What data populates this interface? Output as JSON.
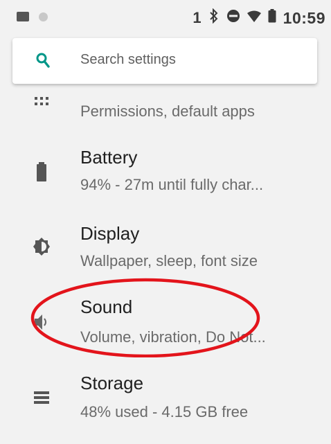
{
  "status_bar": {
    "left_icons": [
      "image-icon",
      "circle-icon"
    ],
    "notification_count": "1",
    "time": "10:59",
    "right_icons": [
      "bluetooth-icon",
      "do-not-disturb-icon",
      "wifi-icon",
      "battery-icon"
    ]
  },
  "search": {
    "placeholder": "Search settings",
    "icon": "search-icon",
    "accent_color": "#009688"
  },
  "settings_items": [
    {
      "title": "",
      "summary": "Permissions, default apps",
      "icon": "apps-icon"
    },
    {
      "title": "Battery",
      "summary": "94% - 27m until fully char...",
      "icon": "battery-icon"
    },
    {
      "title": "Display",
      "summary": "Wallpaper, sleep, font size",
      "icon": "brightness-icon"
    },
    {
      "title": "Sound",
      "summary": "Volume, vibration, Do Not...",
      "icon": "volume-icon"
    },
    {
      "title": "Storage",
      "summary": "48% used - 4.15 GB free",
      "icon": "storage-icon"
    }
  ],
  "annotation": {
    "shape": "ellipse",
    "color": "#e3141b",
    "highlights": "Sound"
  }
}
